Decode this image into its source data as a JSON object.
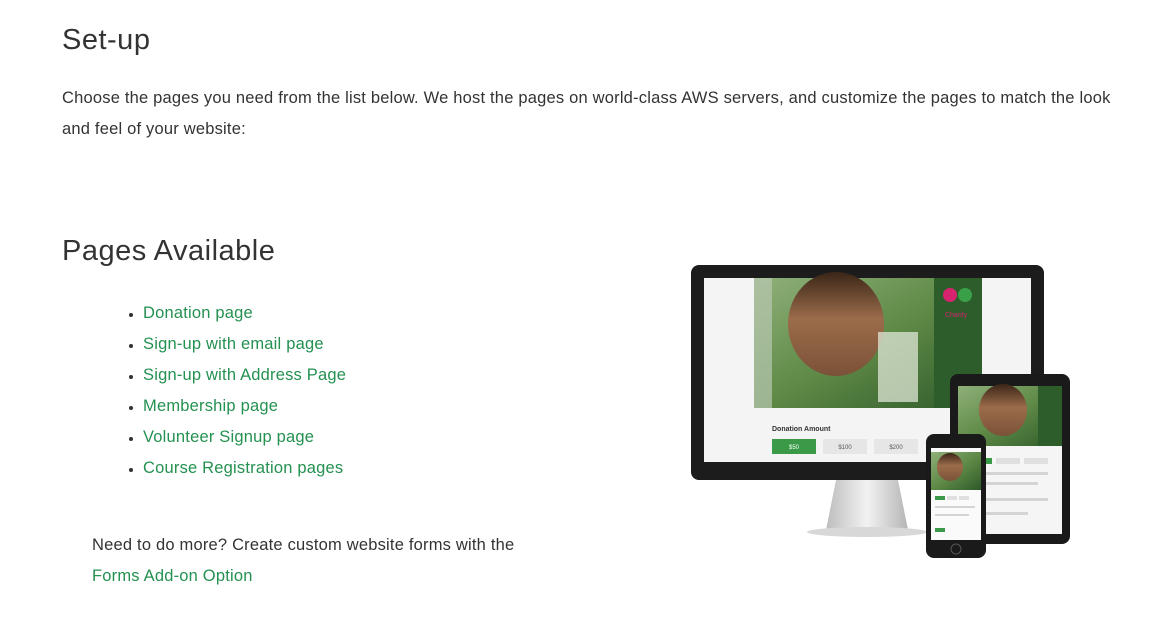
{
  "setup": {
    "title": "Set-up",
    "intro": "Choose the pages you need from the list below. We host the pages on world-class AWS servers, and customize the pages to match the look and feel of your website:"
  },
  "pages": {
    "title": "Pages Available",
    "items": [
      {
        "label": "Donation page"
      },
      {
        "label": "Sign-up with email page"
      },
      {
        "label": "Sign-up with Address Page"
      },
      {
        "label": "Membership page"
      },
      {
        "label": "Volunteer Signup page"
      },
      {
        "label": "Course Registration pages"
      }
    ]
  },
  "more": {
    "text": "Need to do more? Create custom website forms with the ",
    "link_label": "Forms Add-on Option"
  },
  "illustration": {
    "logo_text": "Charity",
    "donation_amount_label": "Donation Amount",
    "amounts": [
      "$50",
      "$100",
      "$200"
    ],
    "colors": {
      "link_green": "#249151",
      "button_green": "#3a9a47",
      "logo_pink": "#d6246e"
    }
  }
}
